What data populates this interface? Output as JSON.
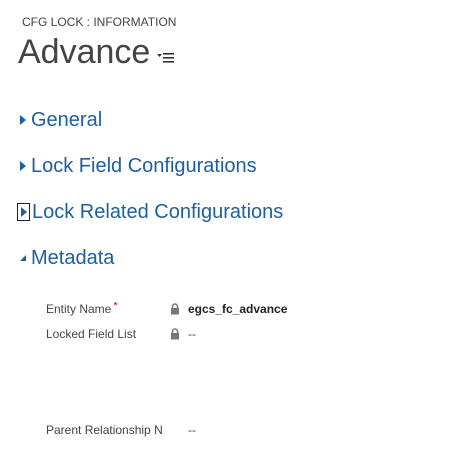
{
  "header": {
    "entity_label": "CFG LOCK : INFORMATION",
    "record_title": "Advance"
  },
  "sections": [
    {
      "label": "General",
      "expanded": false
    },
    {
      "label": "Lock Field Configurations",
      "expanded": false
    },
    {
      "label": "Lock Related Configurations",
      "expanded": false
    },
    {
      "label": "Metadata",
      "expanded": true
    }
  ],
  "metadata": {
    "entity_name": {
      "label": "Entity Name",
      "required_marker": "*",
      "value": "egcs_fc_advance"
    },
    "locked_field_list": {
      "label": "Locked Field List",
      "value": "--"
    },
    "parent_relationship": {
      "label": "Parent Relationship N",
      "value": "--"
    }
  },
  "colors": {
    "section_link": "#1f5f9e",
    "text": "#444444",
    "required": "#cc0000"
  },
  "icons": {
    "collapsed_arrow": "triangle-right-icon",
    "expanded_arrow": "triangle-down-left-icon",
    "form_selector": "list-menu-icon",
    "lock": "lock-icon"
  }
}
